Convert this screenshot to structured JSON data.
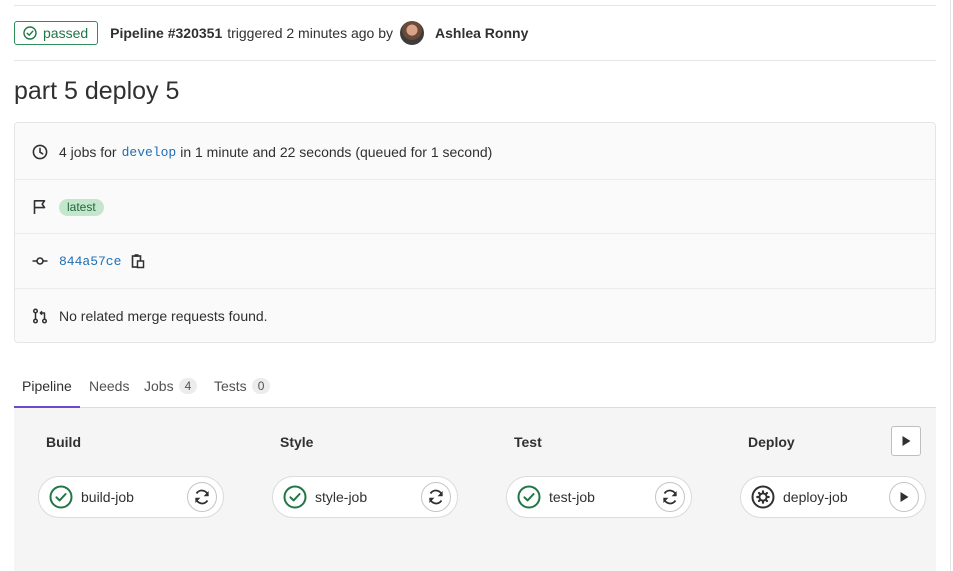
{
  "header": {
    "status_label": "passed",
    "pipeline_id": "Pipeline #320351",
    "triggered_text": "triggered 2 minutes ago by",
    "author": "Ashlea Ronny"
  },
  "title": "part 5 deploy 5",
  "info": {
    "jobs_prefix": "4 jobs for",
    "branch": "develop",
    "duration_text": "in 1 minute and 22 seconds (queued for 1 second)",
    "tag": "latest",
    "commit_sha": "844a57ce",
    "merge_requests_text": "No related merge requests found."
  },
  "tabs": [
    {
      "label": "Pipeline",
      "count": null,
      "active": true
    },
    {
      "label": "Needs",
      "count": null,
      "active": false
    },
    {
      "label": "Jobs",
      "count": "4",
      "active": false
    },
    {
      "label": "Tests",
      "count": "0",
      "active": false
    }
  ],
  "stages": [
    {
      "title": "Build",
      "job": {
        "name": "build-job",
        "status": "success",
        "action": "retry"
      }
    },
    {
      "title": "Style",
      "job": {
        "name": "style-job",
        "status": "success",
        "action": "retry"
      }
    },
    {
      "title": "Test",
      "job": {
        "name": "test-job",
        "status": "success",
        "action": "retry"
      }
    },
    {
      "title": "Deploy",
      "job": {
        "name": "deploy-job",
        "status": "manual",
        "action": "play"
      }
    }
  ],
  "colors": {
    "success": "#217645",
    "link": "#1f6fb5",
    "active_tab": "#6e49cb"
  },
  "icons": [
    "check-circle-icon",
    "clock-icon",
    "flag-icon",
    "commit-icon",
    "clipboard-icon",
    "merge-request-icon",
    "retry-icon",
    "play-icon",
    "gear-icon"
  ]
}
